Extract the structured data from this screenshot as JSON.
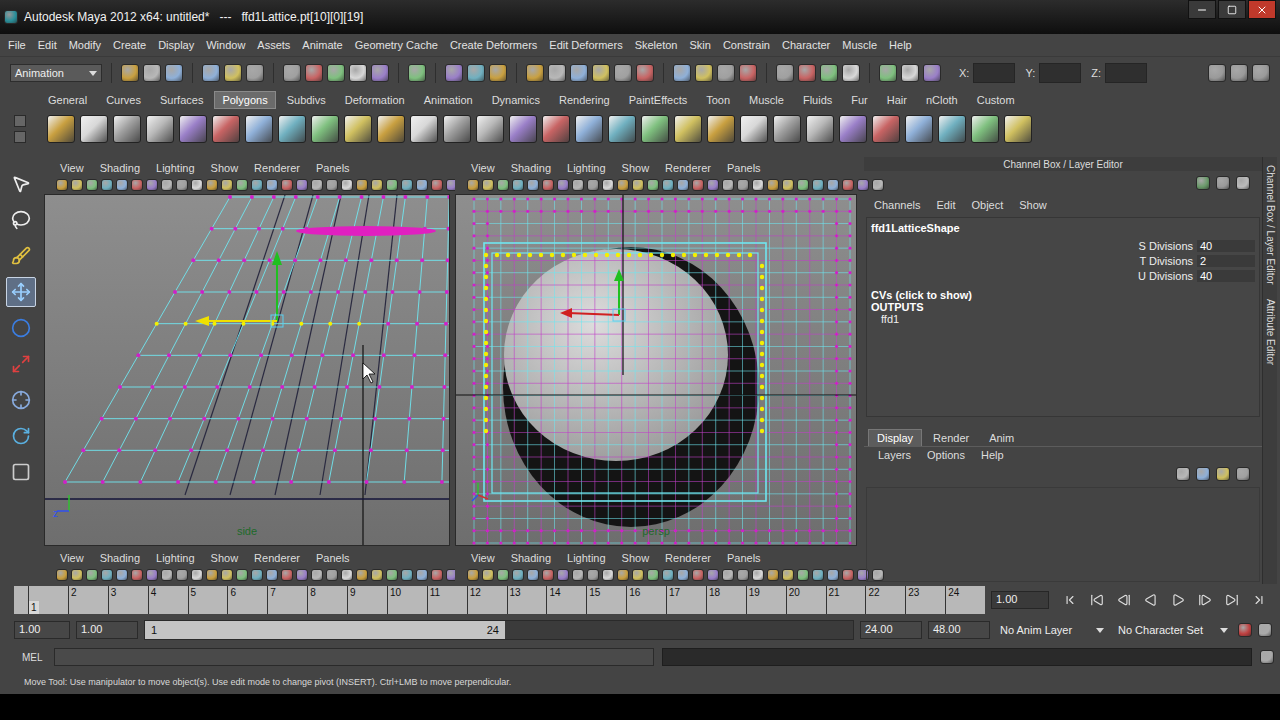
{
  "window": {
    "title": "Autodesk Maya 2012 x64: untitled*   ---   ffd1Lattice.pt[10][0][19]"
  },
  "menu_bar": [
    "File",
    "Edit",
    "Modify",
    "Create",
    "Display",
    "Window",
    "Assets",
    "Animate",
    "Geometry Cache",
    "Create Deformers",
    "Edit Deformers",
    "Skeleton",
    "Skin",
    "Constrain",
    "Character",
    "Muscle",
    "Help"
  ],
  "status_line": {
    "mode": "Animation",
    "coordinates": [
      "X:",
      "Y:",
      "Z:"
    ]
  },
  "shelf": {
    "tabs": [
      {
        "label": "General",
        "selected": false
      },
      {
        "label": "Curves",
        "selected": false
      },
      {
        "label": "Surfaces",
        "selected": false
      },
      {
        "label": "Polygons",
        "selected": true
      },
      {
        "label": "Subdivs",
        "selected": false
      },
      {
        "label": "Deformation",
        "selected": false
      },
      {
        "label": "Animation",
        "selected": false
      },
      {
        "label": "Dynamics",
        "selected": false
      },
      {
        "label": "Rendering",
        "selected": false
      },
      {
        "label": "PaintEffects",
        "selected": false
      },
      {
        "label": "Toon",
        "selected": false
      },
      {
        "label": "Muscle",
        "selected": false
      },
      {
        "label": "Fluids",
        "selected": false
      },
      {
        "label": "Fur",
        "selected": false
      },
      {
        "label": "Hair",
        "selected": false
      },
      {
        "label": "nCloth",
        "selected": false
      },
      {
        "label": "Custom",
        "selected": false
      }
    ]
  },
  "toolbox": [
    {
      "selected": false
    },
    {
      "selected": false
    },
    {
      "selected": false
    },
    {
      "selected": true
    },
    {
      "selected": false
    },
    {
      "selected": false
    },
    {
      "selected": false
    },
    {
      "selected": false
    },
    {
      "selected": false
    }
  ],
  "viewport_menu": [
    "View",
    "Shading",
    "Lighting",
    "Show",
    "Renderer",
    "Panels"
  ],
  "viewports": [
    {
      "camera": "side",
      "gizmo": "z",
      "expanded": true
    },
    {
      "camera": "persp",
      "expanded": true
    },
    {
      "expanded": false
    },
    {
      "expanded": false
    }
  ],
  "channel_box": {
    "title": "Channel Box / Layer Editor",
    "menu": [
      "Channels",
      "Edit",
      "Object",
      "Show"
    ],
    "node": "ffd1LatticeShape",
    "attributes": [
      {
        "name": "S Divisions",
        "value": "40"
      },
      {
        "name": "T Divisions",
        "value": "2"
      },
      {
        "name": "U Divisions",
        "value": "40"
      }
    ],
    "cvs": "CVs (click to show)",
    "outputs_label": "OUTPUTS",
    "outputs": [
      "ffd1"
    ],
    "layer_tabs": [
      {
        "label": "Display",
        "selected": true
      },
      {
        "label": "Render",
        "selected": false
      },
      {
        "label": "Anim",
        "selected": false
      }
    ],
    "layer_menu": [
      "Layers",
      "Options",
      "Help"
    ]
  },
  "side_tabs": [
    "Channel Box / Layer Editor",
    "Attribute Editor"
  ],
  "time_slider": {
    "ticks": [
      "1",
      "2",
      "3",
      "4",
      "5",
      "6",
      "7",
      "8",
      "9",
      "10",
      "11",
      "12",
      "13",
      "14",
      "15",
      "16",
      "17",
      "18",
      "19",
      "20",
      "21",
      "22",
      "23",
      "24"
    ],
    "current": "1",
    "current_field": "1.00"
  },
  "range_slider": {
    "start": "1.00",
    "range_start": "1.00",
    "bar_start": "1",
    "bar_end": "24",
    "range_end": "24.00",
    "end": "48.00",
    "anim_layer": "No Anim Layer",
    "character_set": "No Character Set"
  },
  "command_line": {
    "language": "MEL"
  },
  "help_line": "Move Tool: Use manipulator to move object(s). Use edit mode to change pivot (INSERT). Ctrl+LMB to move perpendicular."
}
